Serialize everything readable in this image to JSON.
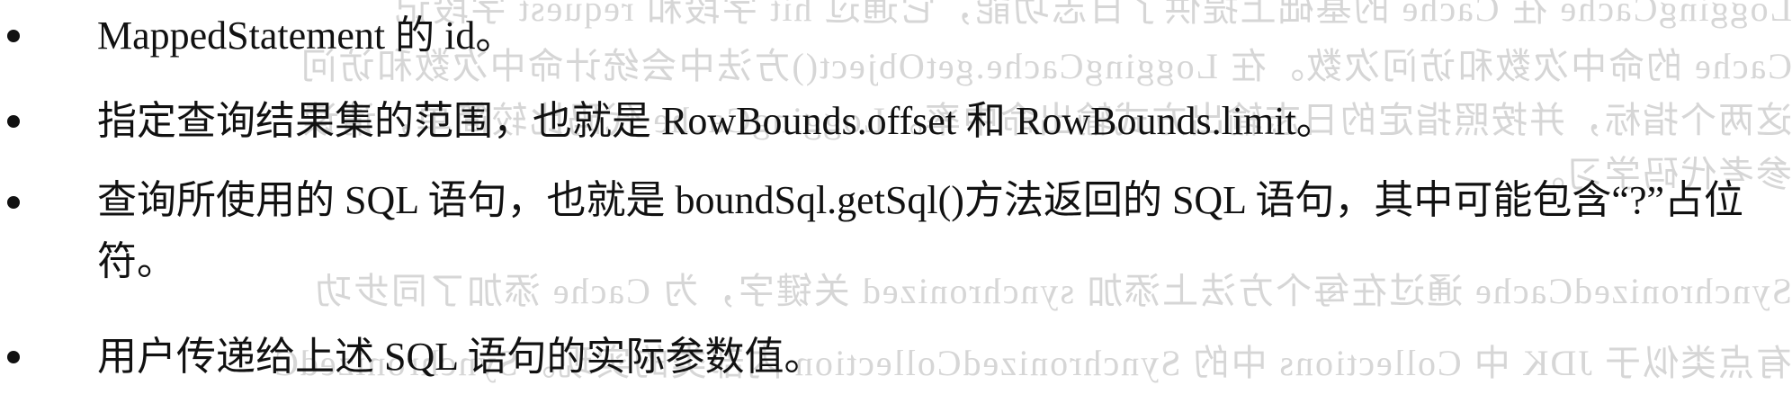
{
  "bullets": [
    {
      "text": "MappedStatement 的 id。"
    },
    {
      "text": "指定查询结果集的范围，也就是 RowBounds.offset 和 RowBounds.limit。"
    },
    {
      "text": "查询所使用的 SQL 语句，也就是 boundSql.getSql()方法返回的 SQL 语句，其中可能包含“?”占位符。"
    },
    {
      "text": "用户传递给上述 SQL 语句的实际参数值。"
    }
  ],
  "bleed_through": [
    "LoggingCache 在 Cache 的基础上提供了日志功能，它通过 hit 字段和 request 字段记",
    "Cache 的命中次数和访问次数。在 LoggingCache.getObject()方法中会统计命中次数和访问",
    "这两个指标，并按照指定的日志输出方式输出命中率。LoggingCache 代码比较简单，请读",
    "参考代码学习。",
    "SynchronizedCache 通过在每个方法上添加 synchronized 关键字，为 Cache 添加了同步功",
    "有点类似于 JDK 中 Collections 中的 SynchronizedCollection 内部类的实现。SynchronizedC"
  ]
}
